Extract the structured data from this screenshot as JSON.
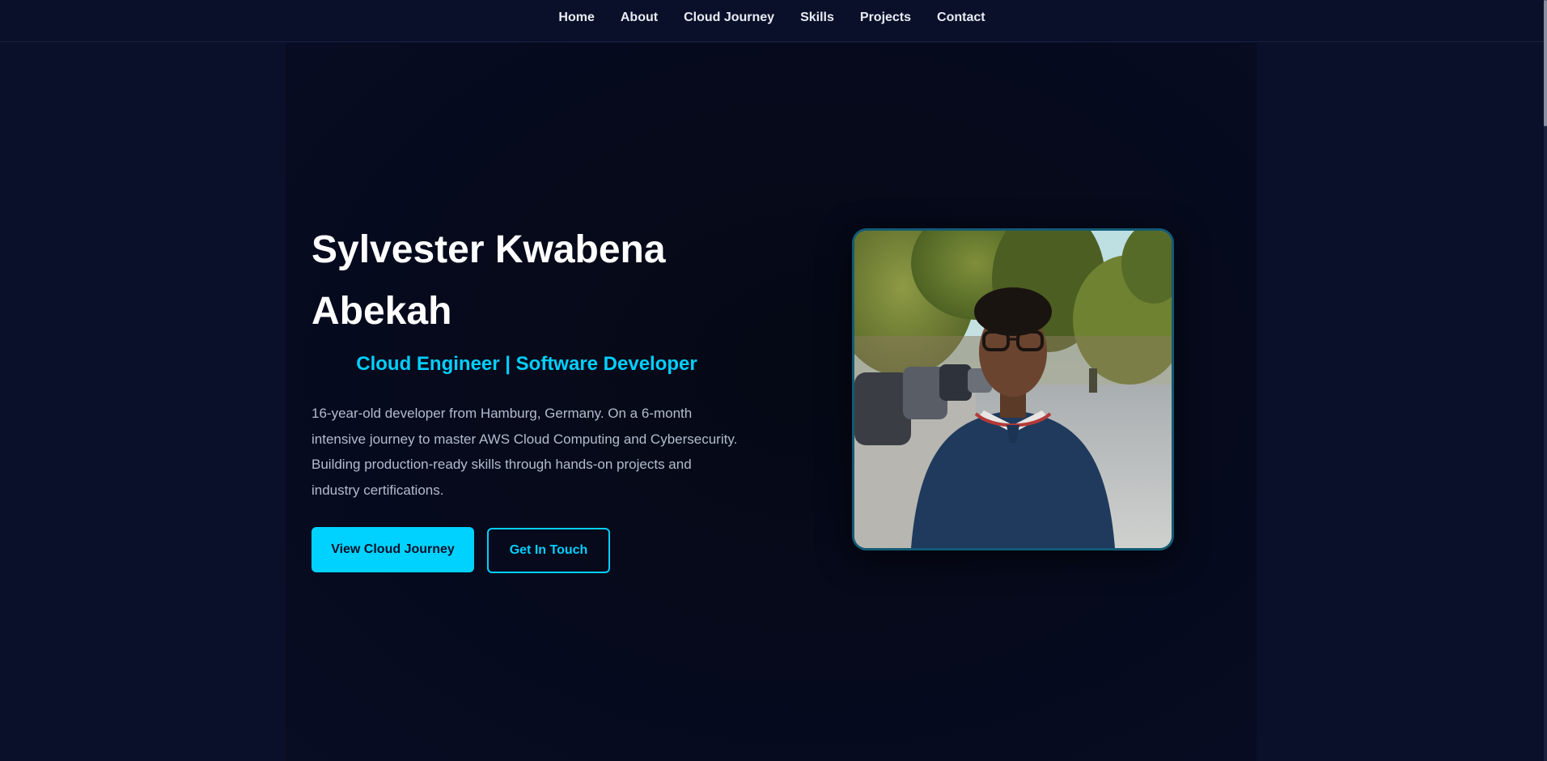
{
  "nav": {
    "items": [
      {
        "label": "Home"
      },
      {
        "label": "About"
      },
      {
        "label": "Cloud Journey"
      },
      {
        "label": "Skills"
      },
      {
        "label": "Projects"
      },
      {
        "label": "Contact"
      }
    ]
  },
  "hero": {
    "name": "Sylvester Kwabena Abekah",
    "subtitle": "Cloud Engineer | Software Developer",
    "description": "16-year-old developer from Hamburg, Germany. On a 6-month intensive journey to master AWS Cloud Computing and Cybersecurity. Building production-ready skills through hands-on projects and industry certifications.",
    "primary_button": "View Cloud Journey",
    "secondary_button": "Get In Touch"
  },
  "colors": {
    "accent": "#00d2ff",
    "background": "#0a0f2a",
    "text": "#ffffff"
  }
}
